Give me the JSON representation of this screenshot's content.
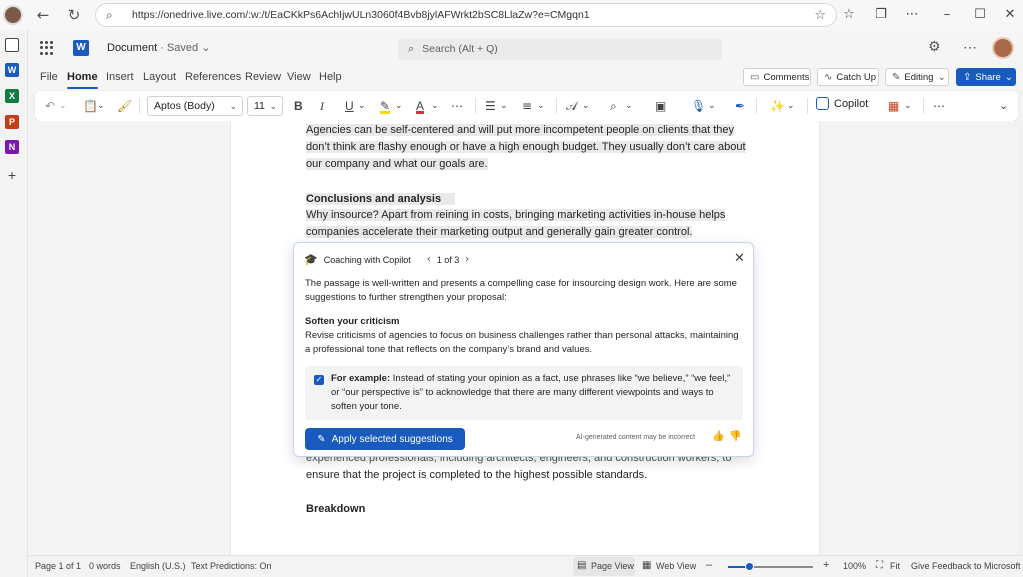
{
  "browser": {
    "url": "https://onedrive.live.com/:w:/t/EaCKkPs6AchIjwULn3060f4Bvb8jylAFWrkt2bSC8LlaZw?e=CMgqn1",
    "back_icon": "back-arrow-icon",
    "refresh_icon": "refresh-icon"
  },
  "rail": {
    "apps": [
      "copilot",
      "word",
      "excel",
      "powerpoint",
      "onenote",
      "add"
    ],
    "letters": {
      "word": "W",
      "excel": "X",
      "powerpoint": "P",
      "onenote": "N",
      "add": "+"
    },
    "colors": {
      "word": "#185abd",
      "excel": "#107c41",
      "powerpoint": "#c43e1c",
      "onenote": "#7719aa"
    }
  },
  "header": {
    "doc_name": "Document",
    "saved_status": "· Saved",
    "search_placeholder": "Search (Alt + Q)",
    "logo_letter": "W"
  },
  "ribbon": {
    "tabs": [
      "File",
      "Home",
      "Insert",
      "Layout",
      "References",
      "Review",
      "View",
      "Help"
    ],
    "active_tab": "Home",
    "comments": "Comments",
    "catch_up": "Catch Up",
    "editing": "Editing",
    "share": "Share"
  },
  "toolbar": {
    "font_name": "Aptos (Body)",
    "font_size": "11",
    "bold": "B",
    "italic": "I",
    "underline": "U",
    "copilot": "Copilot"
  },
  "document": {
    "para1": "Agencies can be self-centered and will put more incompetent people on clients that they don’t think are flashy enough or have a high enough budget. They usually don’t care about our company and what our goals are.",
    "heading1": "Conclusions and analysis",
    "para2": "Why insource? Apart from reining in costs, bringing marketing activities in-house helps companies accelerate their marketing output and generally gain greater control.",
    "para3_partial": "experienced professionals, including architects, engineers, and construction workers, to",
    "para3_end": "ensure that the project is completed to the highest possible standards.",
    "heading2": "Breakdown"
  },
  "coaching": {
    "title": "Coaching with Copilot",
    "pager": "1 of 3",
    "intro": "The passage is well-written and presents a compelling case for insourcing design work. Here are some suggestions to further strengthen your proposal:",
    "subheading": "Soften your criticism",
    "suggestion": "Revise criticisms of agencies to focus on business challenges rather than personal attacks, maintaining a professional tone that reflects on the company’s brand and values.",
    "example_label": "For example:",
    "example_text": "Instead of stating your opinion as a fact, use phrases like “we believe,” “we feel,” or “our perspective is” to acknowledge that there are many different viewpoints and ways to soften your tone.",
    "apply_button": "Apply selected suggestions",
    "ai_note": "AI-generated content may be incorrect"
  },
  "status": {
    "page": "Page 1 of 1",
    "words": "0 words",
    "language": "English (U.S.)",
    "predictions": "Text Predictions: On",
    "page_view": "Page View",
    "web_view": "Web View",
    "zoom": "100%",
    "fit": "Fit",
    "feedback": "Give Feedback to Microsoft",
    "zoom_level": 0.25
  }
}
